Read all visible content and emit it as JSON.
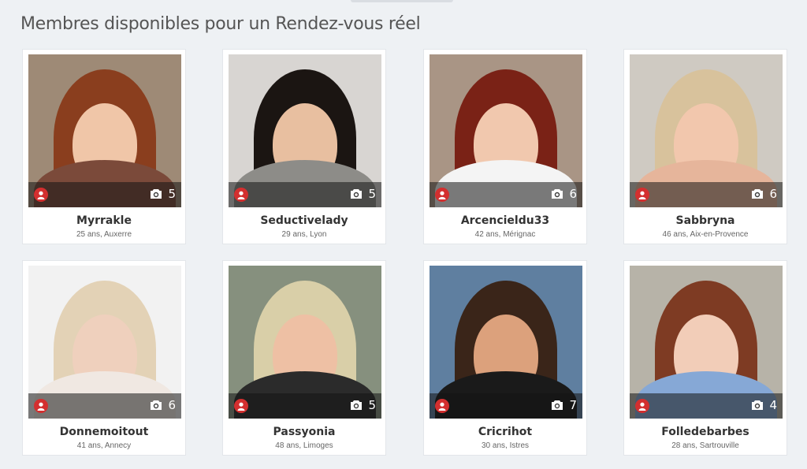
{
  "page": {
    "title": "Membres disponibles pour un Rendez-vous réel"
  },
  "icons": {
    "user": "user-icon",
    "camera": "camera-icon"
  },
  "colors": {
    "badge": "#d32f2f",
    "background": "#eef1f4"
  },
  "members": [
    {
      "name": "Myrrakle",
      "info": "25 ans, Auxerre",
      "photos": "5",
      "skin": "#f0c6a8",
      "hair": "#8a3e1e",
      "bg": "#9e8a76",
      "top": "#7b4a3a"
    },
    {
      "name": "Seductivelady",
      "info": "29 ans, Lyon",
      "photos": "5",
      "skin": "#e8bfa0",
      "hair": "#1b1512",
      "bg": "#d8d5d2",
      "top": "#8d8c88"
    },
    {
      "name": "Arcencieldu33",
      "info": "42 ans, Mérignac",
      "photos": "6",
      "skin": "#f1c8ae",
      "hair": "#7a2216",
      "bg": "#a99585",
      "top": "#f4f4f4"
    },
    {
      "name": "Sabbryna",
      "info": "46 ans, Aix-en-Provence",
      "photos": "6",
      "skin": "#f2c7ad",
      "hair": "#d8c29c",
      "bg": "#cfcac2",
      "top": "#e6b59b"
    },
    {
      "name": "Donnemoitout",
      "info": "41 ans, Annecy",
      "photos": "6",
      "skin": "#efd0bd",
      "hair": "#e3d2b6",
      "bg": "#f2f2f2",
      "top": "#f0e8e2"
    },
    {
      "name": "Passyonia",
      "info": "48 ans, Limoges",
      "photos": "5",
      "skin": "#eec0a4",
      "hair": "#d9cfa8",
      "bg": "#86907e",
      "top": "#2b2b2b"
    },
    {
      "name": "Cricrihot",
      "info": "30 ans, Istres",
      "photos": "7",
      "skin": "#dca17c",
      "hair": "#3a2519",
      "bg": "#5f7fa0",
      "top": "#1a1a1a"
    },
    {
      "name": "Folledebarbes",
      "info": "28 ans, Sartrouville",
      "photos": "4",
      "skin": "#f2cdb8",
      "hair": "#7e3b23",
      "bg": "#b7b3a8",
      "top": "#86a8d6"
    }
  ]
}
